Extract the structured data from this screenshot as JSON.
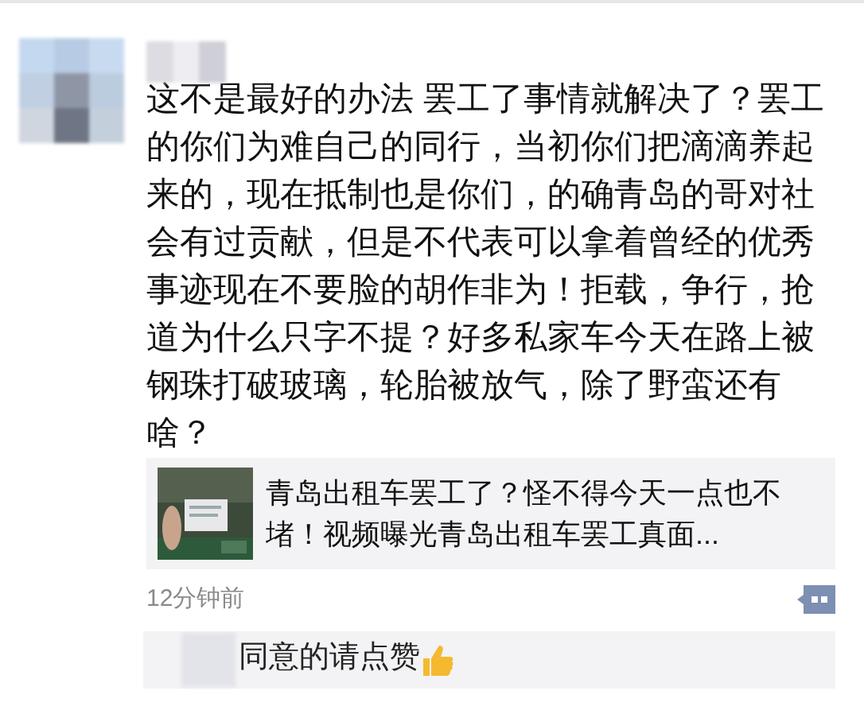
{
  "post": {
    "text": "这不是最好的办法 罢工了事情就解决了？罢工的你们为难自己的同行，当初你们把滴滴养起来的，现在抵制也是你们，的确青岛的哥对社会有过贡献，但是不代表可以拿着曾经的优秀事迹现在不要脸的胡作非为！拒载，争行，抢道为什么只字不提？好多私家车今天在路上被钢珠打破玻璃，轮胎被放气，除了野蛮还有啥？",
    "link": {
      "kind": "picture",
      "title": "青岛出租车罢工了？怪不得今天一点也不堵！视频曝光青岛出租车罢工真面..."
    },
    "time": "12分钟前",
    "comments": [
      {
        "text": "同意的请点赞"
      }
    ]
  }
}
